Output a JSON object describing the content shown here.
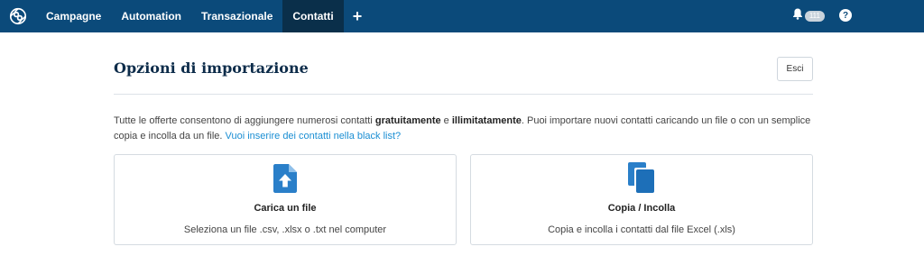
{
  "topnav": {
    "items": [
      {
        "label": "Campagne",
        "active": false
      },
      {
        "label": "Automation",
        "active": false
      },
      {
        "label": "Transazionale",
        "active": false
      },
      {
        "label": "Contatti",
        "active": true
      }
    ],
    "plus_label": "+",
    "notifications_badge": "111",
    "help_label": "?"
  },
  "page": {
    "title": "Opzioni di importazione",
    "exit_label": "Esci",
    "intro": {
      "part1": "Tutte le offerte consentono di aggiungere numerosi contatti ",
      "bold1": "gratuitamente",
      "part2": " e ",
      "bold2": "illimitatamente",
      "part3": ". Puoi importare nuovi contatti caricando un file o con un semplice copia e incolla da un file. ",
      "link": "Vuoi inserire dei contatti nella black list?"
    }
  },
  "cards": [
    {
      "title": "Carica un file",
      "description": "Seleziona un file .csv, .xlsx o .txt nel computer",
      "icon": "upload-file-icon"
    },
    {
      "title": "Copia / Incolla",
      "description": "Copia e incolla i contatti dal file Excel (.xls)",
      "icon": "copy-icon"
    }
  ],
  "colors": {
    "topbar": "#0b4a7a",
    "active_tab": "#0a2f4a",
    "accent": "#2a7fc9",
    "link": "#1a8ed3"
  }
}
